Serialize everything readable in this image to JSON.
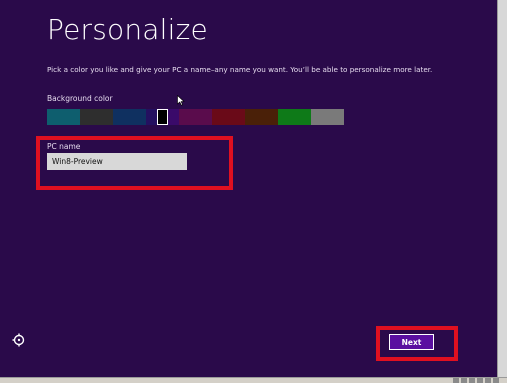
{
  "page": {
    "title": "Personalize",
    "subtitle": "Pick a color you like and give your PC a name–any name you want. You’ll be able to personalize more later."
  },
  "background": {
    "label": "Background color",
    "swatches": [
      "#0e5e6e",
      "#2e2e2e",
      "#0f3060",
      "#241060",
      "#000000",
      "#3a0a6a",
      "#5a0c4c",
      "#6a0a18",
      "#4a2008",
      "#0e7a18",
      "#7a7a7a"
    ],
    "selected_index": 4
  },
  "pc_name": {
    "label": "PC name",
    "value": "Win8-Preview"
  },
  "next_button": {
    "label": "Next"
  },
  "icons": {
    "ease_of_access": "ease-of-access-icon",
    "cursor": "mouse-pointer-icon"
  },
  "colors": {
    "background": "#2a0a4a",
    "accent": "#5a0fa0",
    "highlight": "#e01020"
  }
}
